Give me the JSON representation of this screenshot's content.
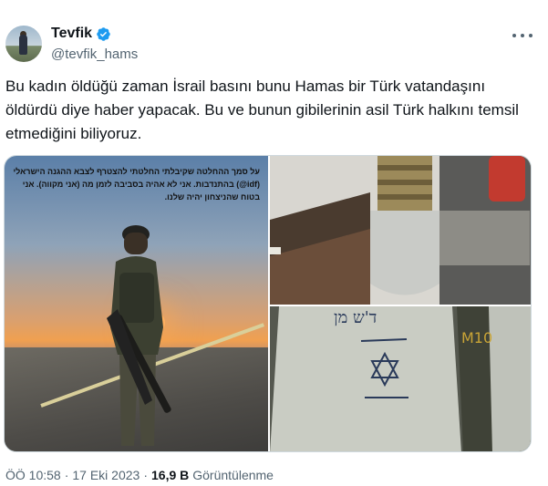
{
  "author": {
    "display_name": "Tevfik",
    "handle": "@tevfik_hams",
    "verified_icon": "verified-badge-icon",
    "accent": "#1d9bf0"
  },
  "tweet": {
    "text": "Bu kadın öldüğü zaman İsrail basını bunu Hamas bir Türk vatandaşını öldürdü diye haber yapacak. Bu ve bunun gibilerinin asil Türk halkını temsil etmediğini biliyoruz.",
    "image_1_caption": "על סמך ההחלטה שקיבלתי החלטתי להצטרף לצבא ההגנה הישראלי (idf@) בהתנדבות. אני לא אהיה בסביבה לזמן מה (אני מקווה). אני בטוח שהניצחון יהיה שלנו.",
    "image_3_handwriting": "ד'ש מן"
  },
  "meta": {
    "time": "ÖÖ 10:58",
    "separator": "·",
    "date": "17 Eki 2023",
    "views_count": "16,9 B",
    "views_label": "Görüntülenme"
  }
}
